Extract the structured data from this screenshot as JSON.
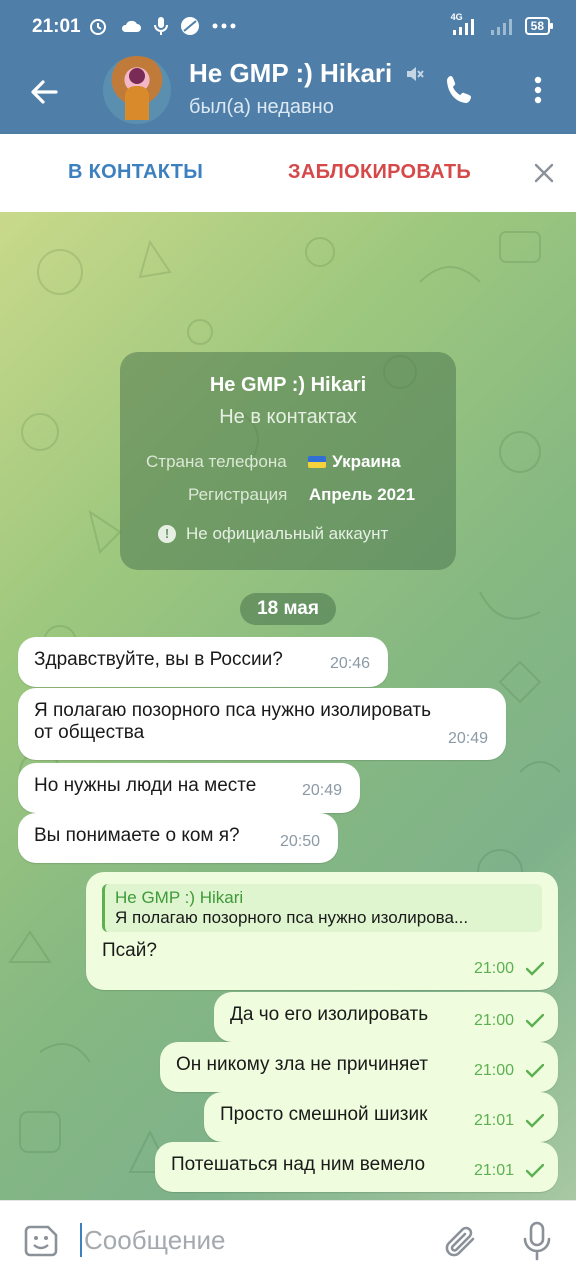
{
  "status_bar": {
    "time": "21:01",
    "icons": [
      "alarm-icon",
      "cloud-icon",
      "mic-icon",
      "no-disturb-icon",
      "more-dots-icon"
    ],
    "network": "4G",
    "battery": "58"
  },
  "header": {
    "name": "Не GMP :) Hikari",
    "status": "был(а) недавно"
  },
  "action_bar": {
    "add_contact": "В КОНТАКТЫ",
    "block": "ЗАБЛОКИРОВАТЬ"
  },
  "info_card": {
    "name": "Не GMP :) Hikari",
    "subtitle": "Не в контактах",
    "country_label": "Страна телефона",
    "country_value": "Украина",
    "reg_label": "Регистрация",
    "reg_value": "Апрель 2021",
    "note": "Не официальный аккаунт"
  },
  "date_separator": "18 мая",
  "messages": [
    {
      "dir": "in",
      "text": "Здравствуйте, вы в России?",
      "time": "20:46"
    },
    {
      "dir": "in",
      "text_line1": "Я полагаю позорного пса нужно изолировать",
      "text_line2": "от общества",
      "time": "20:49"
    },
    {
      "dir": "in",
      "text": "Но нужны люди на месте",
      "time": "20:49"
    },
    {
      "dir": "in",
      "text": "Вы понимаете о ком я?",
      "time": "20:50"
    },
    {
      "dir": "out",
      "reply_name": "Не GMP :) Hikari",
      "reply_text": "Я полагаю позорного пса нужно изолирова...",
      "text": "Псай?",
      "time": "21:00"
    },
    {
      "dir": "out",
      "text": "Да чо его изолировать",
      "time": "21:00"
    },
    {
      "dir": "out",
      "text": "Он никому зла не причиняет",
      "time": "21:00"
    },
    {
      "dir": "out",
      "text": "Просто смешной шизик",
      "time": "21:01"
    },
    {
      "dir": "out",
      "text": "Потешаться над ним вемело",
      "time": "21:01"
    }
  ],
  "input": {
    "placeholder": "Сообщение"
  },
  "colors": {
    "header": "#4f7fa8",
    "outgoing_bubble": "#effdde",
    "check": "#5db052",
    "block_red": "#d5494a",
    "contacts_blue": "#3d80bf"
  }
}
